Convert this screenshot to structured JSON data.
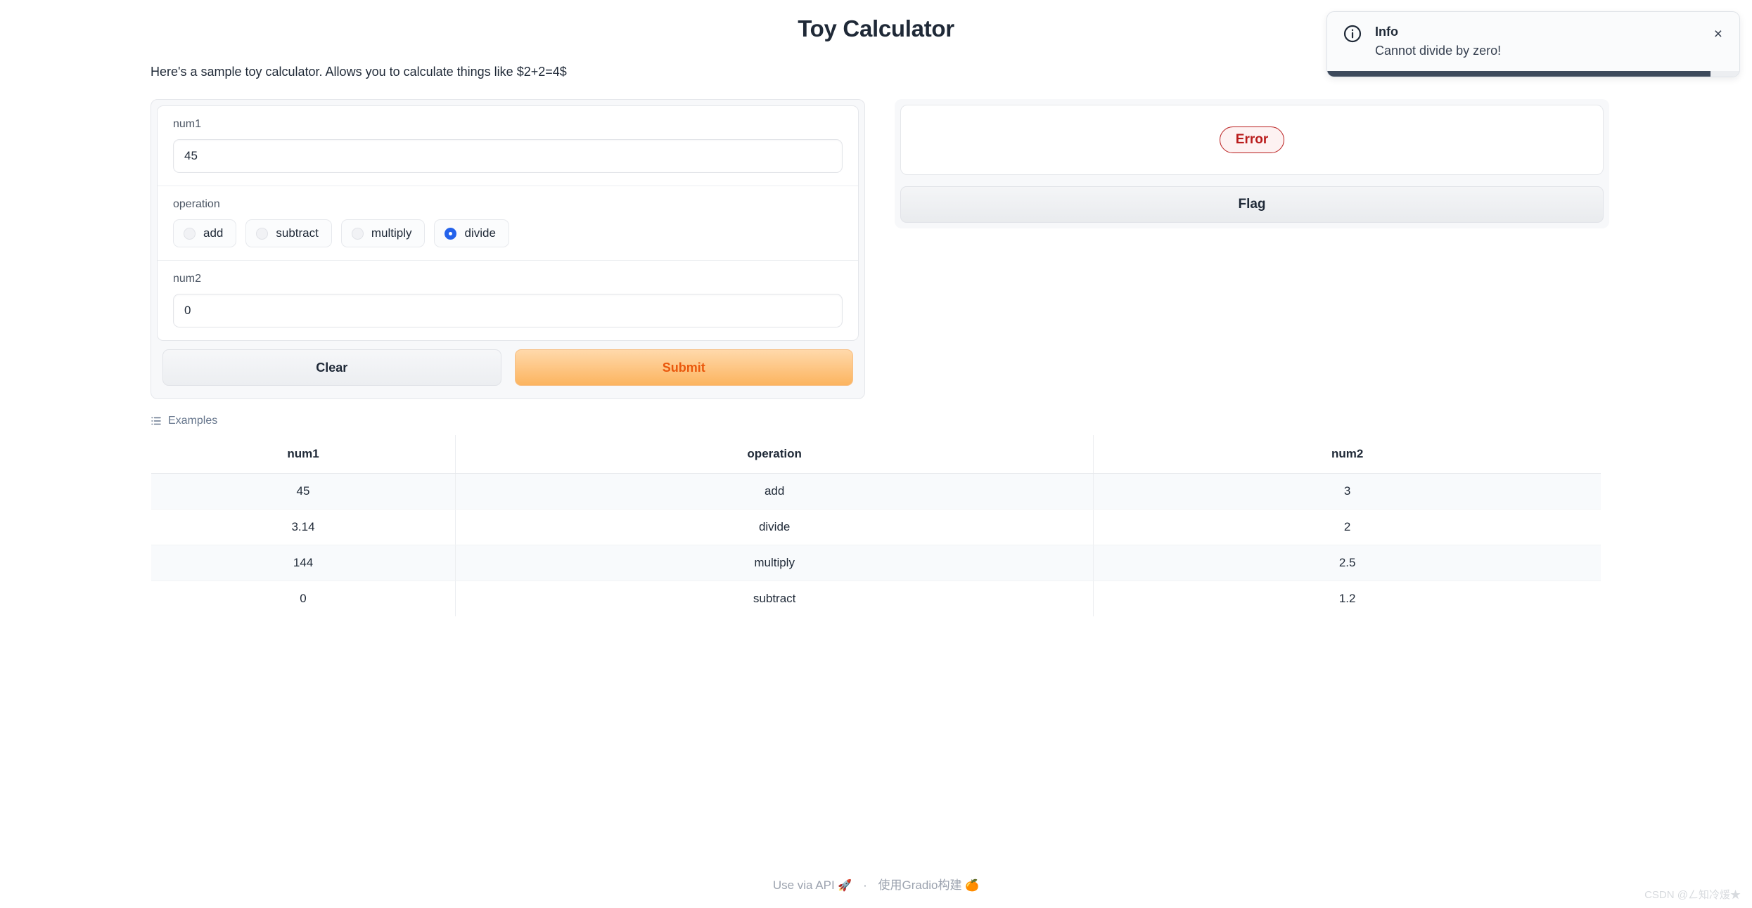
{
  "header": {
    "title": "Toy Calculator",
    "description": "Here's a sample toy calculator. Allows you to calculate things like $2+2=4$"
  },
  "form": {
    "num1": {
      "label": "num1",
      "value": "45",
      "placeholder": ""
    },
    "operation": {
      "label": "operation",
      "selected": "divide",
      "options": [
        "add",
        "subtract",
        "multiply",
        "divide"
      ]
    },
    "num2": {
      "label": "num2",
      "value": "0",
      "placeholder": ""
    },
    "clear_label": "Clear",
    "submit_label": "Submit"
  },
  "output": {
    "status_label": "Error",
    "flag_label": "Flag"
  },
  "examples": {
    "label": "Examples",
    "icon": "list-icon",
    "columns": [
      "num1",
      "operation",
      "num2"
    ],
    "rows": [
      [
        "45",
        "add",
        "3"
      ],
      [
        "3.14",
        "divide",
        "2"
      ],
      [
        "144",
        "multiply",
        "2.5"
      ],
      [
        "0",
        "subtract",
        "1.2"
      ]
    ]
  },
  "toast": {
    "icon": "info-circle-icon",
    "title": "Info",
    "message": "Cannot divide by zero!",
    "close_label": "×",
    "progress_percent": 93,
    "progress_color": "#3d4a5c"
  },
  "footer": {
    "api_label": "Use via API",
    "api_emoji": "🚀",
    "separator": "·",
    "built_with_label": "使用Gradio构建",
    "built_with_emoji": "🍊"
  },
  "watermark": {
    "text": "CSDN @ㄥ知冷煖★"
  },
  "colors": {
    "accent_orange": "#ea580c",
    "radio_blue": "#2563eb",
    "error_red": "#b91c1c"
  }
}
